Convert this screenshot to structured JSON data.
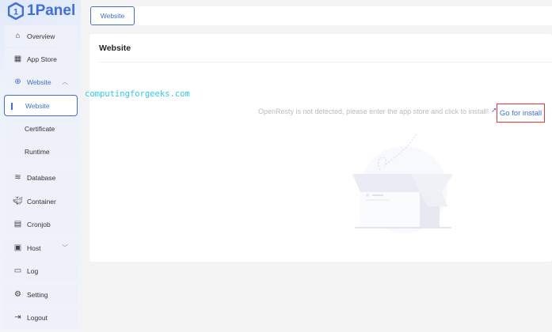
{
  "app": {
    "name": "1Panel"
  },
  "sidebar": {
    "items": [
      {
        "label": "Overview"
      },
      {
        "label": "App Store"
      },
      {
        "label": "Website"
      },
      {
        "label": "Website"
      },
      {
        "label": "Certificate"
      },
      {
        "label": "Runtime"
      },
      {
        "label": "Database"
      },
      {
        "label": "Container"
      },
      {
        "label": "Cronjob"
      },
      {
        "label": "Host"
      },
      {
        "label": "Log"
      },
      {
        "label": "Setting"
      },
      {
        "label": "Logout"
      }
    ]
  },
  "tabs": [
    {
      "label": "Website"
    }
  ],
  "card": {
    "title": "Website",
    "message": "OpenResty is not detected, please enter the app store and click to install!",
    "install_link": "Go for install"
  },
  "watermark": "computingforgeeks.com",
  "colors": {
    "accent": "#3c6fe0",
    "highlight": "#e33333"
  }
}
